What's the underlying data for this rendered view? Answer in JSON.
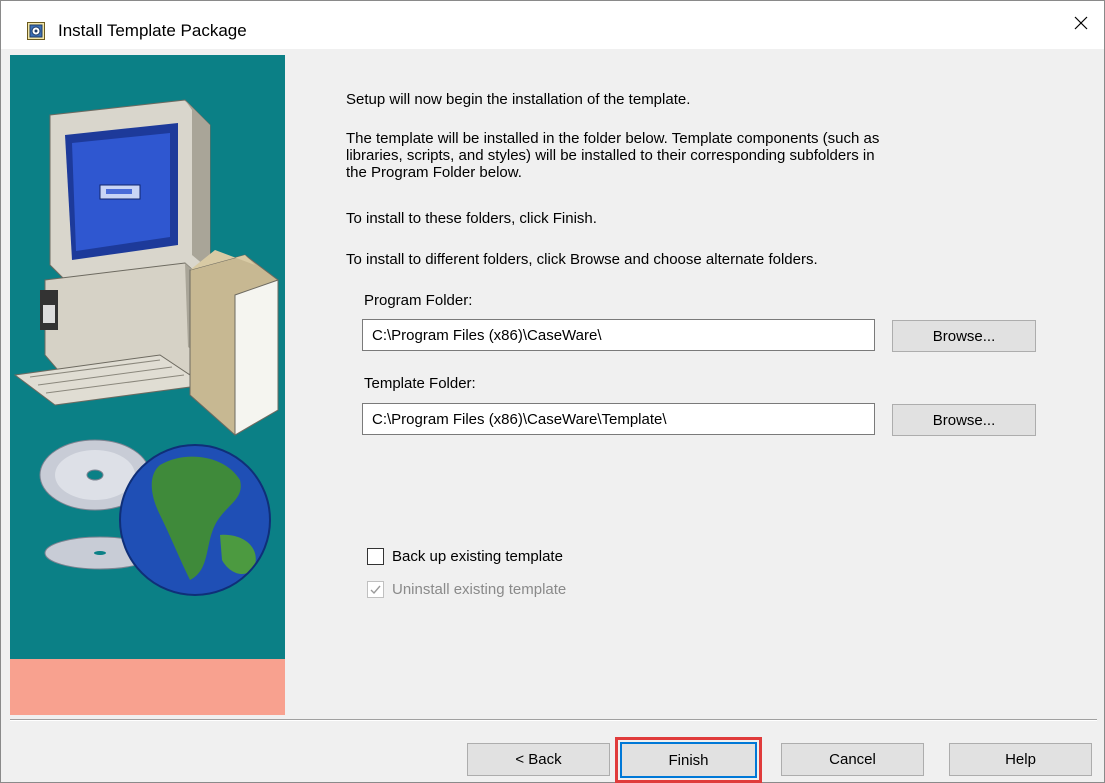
{
  "window": {
    "title": "Install Template Package",
    "icon": "installer-app-icon",
    "close_icon": "close-icon"
  },
  "content": {
    "intro": "Setup will now begin the installation of the template.",
    "description_line1": "The template will be installed in the folder below.  Template components (such as",
    "description_line2": "libraries, scripts, and styles) will be installed to their corresponding subfolders in",
    "description_line3": "the Program Folder below.",
    "finish_hint": "To install to these folders, click Finish.",
    "browse_hint": "To install to different folders, click Browse and choose alternate folders."
  },
  "program_folder": {
    "label": "Program Folder:",
    "value": "C:\\Program Files (x86)\\CaseWare\\",
    "browse_label": "Browse..."
  },
  "template_folder": {
    "label": "Template Folder:",
    "value": "C:\\Program Files (x86)\\CaseWare\\Template\\",
    "browse_label": "Browse..."
  },
  "options": {
    "backup_label": "Back up existing template",
    "backup_checked": false,
    "uninstall_label": "Uninstall existing template",
    "uninstall_checked": true,
    "uninstall_enabled": false
  },
  "buttons": {
    "back": "< Back",
    "finish": "Finish",
    "cancel": "Cancel",
    "help": "Help"
  },
  "colors": {
    "art_background": "#0b8086",
    "art_footer": "#f8a18f",
    "highlight": "#e03b3b",
    "focus_border": "#0078d7"
  }
}
